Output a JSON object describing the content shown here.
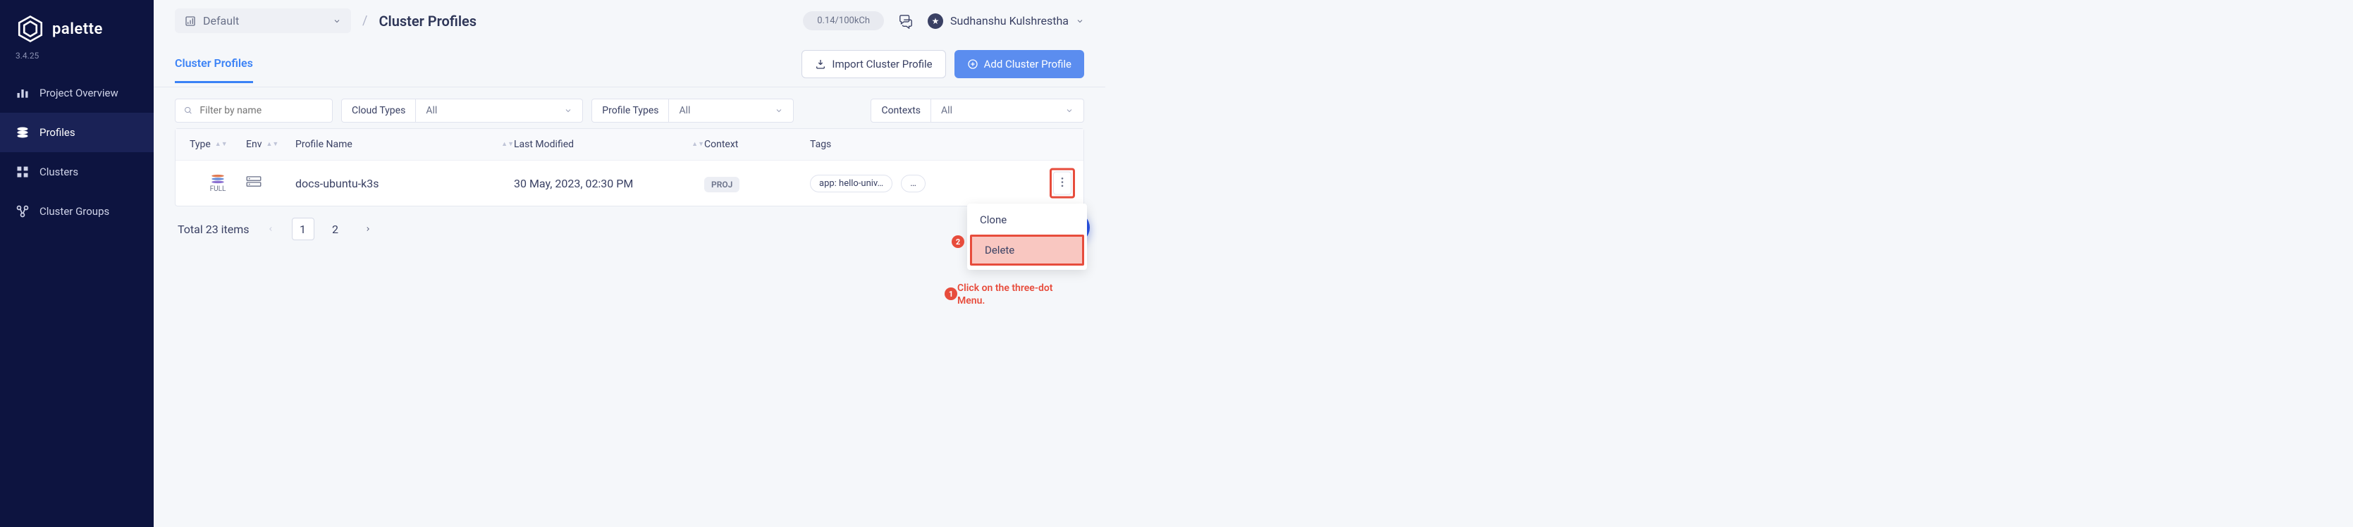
{
  "brand": {
    "name": "palette",
    "version": "3.4.25"
  },
  "sidebar": {
    "items": [
      {
        "label": "Project Overview"
      },
      {
        "label": "Profiles"
      },
      {
        "label": "Clusters"
      },
      {
        "label": "Cluster Groups"
      }
    ]
  },
  "topbar": {
    "project": "Default",
    "breadcrumb_current": "Cluster Profiles",
    "quota": "0.14/100kCh",
    "user": "Sudhanshu Kulshrestha"
  },
  "tabs": {
    "active": "Cluster Profiles"
  },
  "actions": {
    "import": "Import Cluster Profile",
    "add": "Add Cluster Profile"
  },
  "filters": {
    "search_placeholder": "Filter by name",
    "cloud_label": "Cloud Types",
    "cloud_value": "All",
    "profile_label": "Profile Types",
    "profile_value": "All",
    "context_label": "Contexts",
    "context_value": "All"
  },
  "columns": {
    "type": "Type",
    "env": "Env",
    "name": "Profile Name",
    "modified": "Last Modified",
    "context": "Context",
    "tags": "Tags"
  },
  "rows": [
    {
      "type_label": "FULL",
      "name": "docs-ubuntu-k3s",
      "modified": "30 May, 2023, 02:30 PM",
      "context": "PROJ",
      "tags": [
        "app: hello-univ…",
        "…"
      ]
    }
  ],
  "menu": {
    "clone": "Clone",
    "delete": "Delete"
  },
  "pagination": {
    "total_label": "Total 23 items",
    "pages": [
      "1",
      "2"
    ]
  },
  "annotations": {
    "step1": "1",
    "step2": "2",
    "text": "Click on the three-dot Menu."
  },
  "help": "?"
}
